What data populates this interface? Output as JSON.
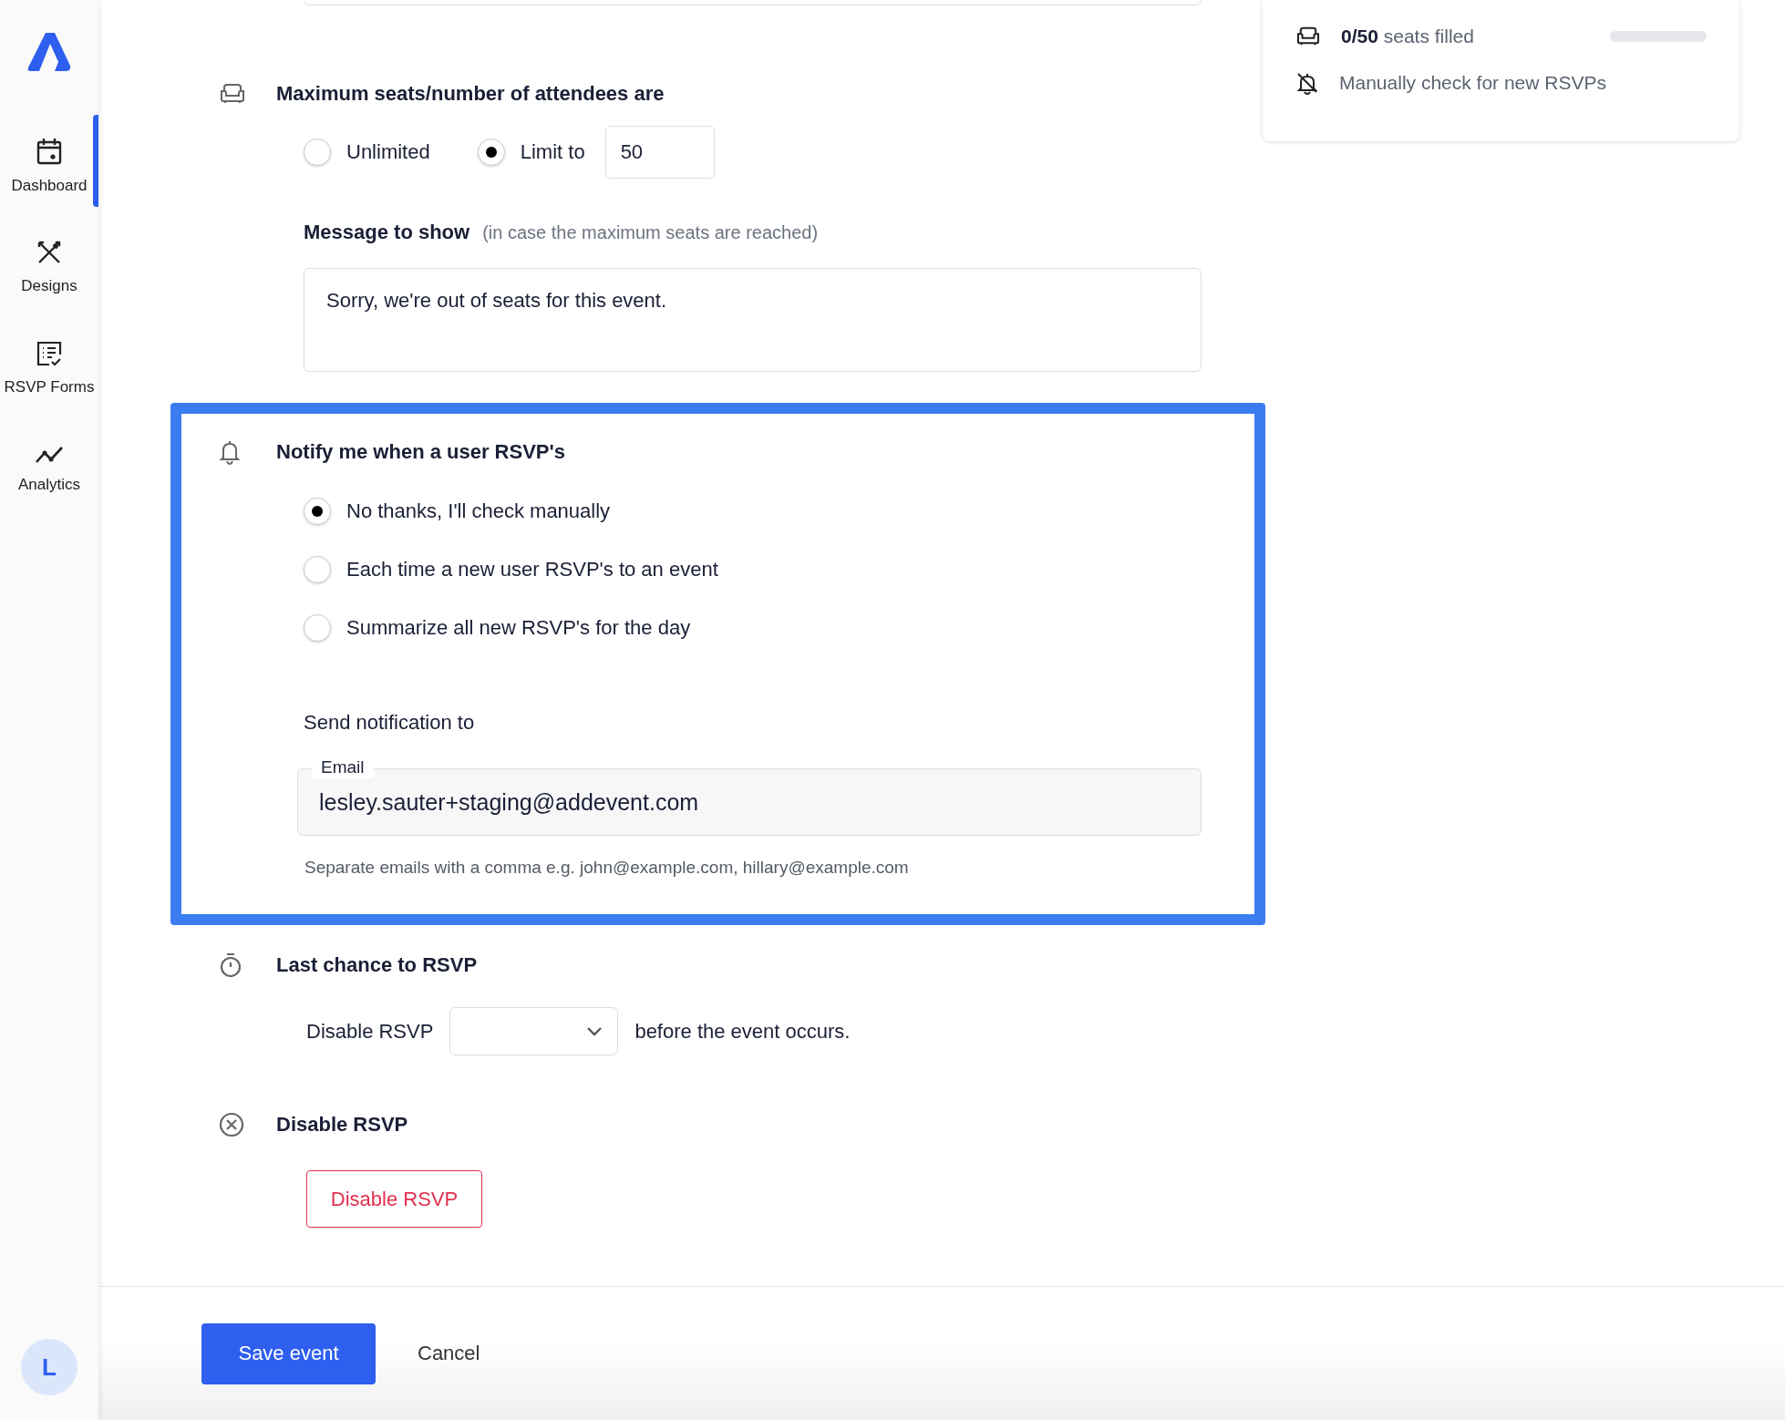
{
  "sidebar": {
    "items": [
      {
        "label": "Dashboard",
        "selected": true
      },
      {
        "label": "Designs",
        "selected": false
      },
      {
        "label": "RSVP Forms",
        "selected": false
      },
      {
        "label": "Analytics",
        "selected": false
      }
    ],
    "avatar": "L"
  },
  "seats": {
    "heading": "Maximum seats/number of attendees are",
    "options": [
      {
        "label": "Unlimited",
        "selected": false
      },
      {
        "label": "Limit to",
        "selected": true
      }
    ],
    "limit_value": "50",
    "message_label": "Message to show",
    "message_hint": "(in case the maximum seats are reached)",
    "message_value": "Sorry, we're out of seats for this event."
  },
  "notify": {
    "highlighted": true,
    "heading": "Notify me when a user RSVP's",
    "options": [
      {
        "label": "No thanks, I'll check manually",
        "selected": true
      },
      {
        "label": "Each time a new user RSVP's to an event",
        "selected": false
      },
      {
        "label": "Summarize all new RSVP's for the day",
        "selected": false
      }
    ],
    "send_label": "Send notification to",
    "email_label": "Email",
    "email_value": "lesley.sauter+staging@addevent.com",
    "helper": "Separate emails with a comma e.g. john@example.com, hillary@example.com"
  },
  "last_chance": {
    "heading": "Last chance to RSVP",
    "prefix": "Disable RSVP",
    "suffix": "before the event occurs."
  },
  "disable": {
    "heading": "Disable RSVP",
    "button": "Disable RSVP"
  },
  "summary": {
    "seats": "**0/50** seats filled",
    "level": 0,
    "notice": "Manually check for new RSVPs"
  },
  "footer": {
    "save": "Save event",
    "cancel": "Cancel"
  }
}
